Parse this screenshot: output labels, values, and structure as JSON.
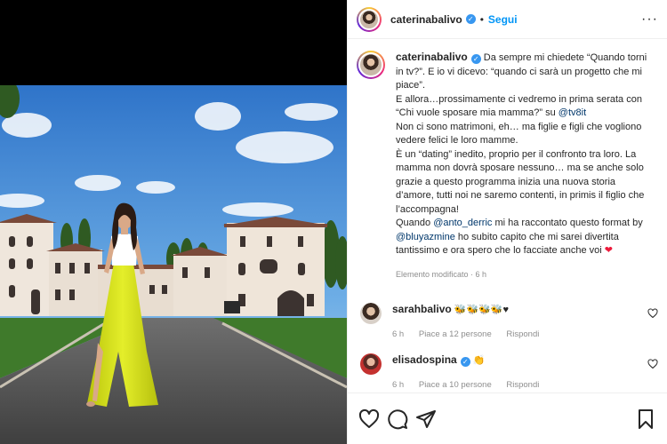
{
  "post": {
    "author": "caterinabalivo",
    "follow_label": "Segui",
    "separator": "•",
    "more_label": "···"
  },
  "caption": {
    "username": "caterinabalivo",
    "line1": "Da sempre mi chiedete “Quando torni in tv?”. E io vi dicevo: “quando ci sarà un progetto che mi piace”.",
    "line2": "E allora…prossimamente ci vedremo in prima serata con “Chi vuole sposare mia mamma?” su ",
    "mention_tv8": "@tv8it",
    "line3": "Non ci sono matrimoni, eh… ma figlie e figli che vogliono vedere felici le loro mamme.",
    "line4": "È un “dating” inedito, proprio per il confronto tra loro. La mamma non dovrà sposare nessuno… ma se anche solo grazie a questo programma inizia una nuova storia d’amore, tutti noi ne saremo contenti, in primis il figlio che l’accompagna!",
    "line5a": "Quando ",
    "mention_anto": "@anto_derric",
    "line5b": " mi ha raccontato questo format by ",
    "mention_blu": "@bluyazmine",
    "line5c": " ho subito capito che mi sarei divertita tantissimo e ora spero che lo facciate anche voi ",
    "heart": "❤",
    "meta": "Elemento modificato · 6 h"
  },
  "comments": [
    {
      "username": "sarahbalivo",
      "text": "🐝🐝🐝🐝♥",
      "time": "6 h",
      "likes": "Piace a 12 persone",
      "reply": "Rispondi"
    },
    {
      "username": "elisadospina",
      "text": "👏",
      "time": "6 h",
      "likes": "Piace a 10 persone",
      "reply": "Rispondi"
    }
  ],
  "icons": {
    "like": "heart-icon",
    "comment": "comment-icon",
    "share": "paper-plane-icon",
    "save": "bookmark-icon",
    "verified": "verified-badge-icon"
  },
  "colors": {
    "accent": "#0095f6",
    "verified": "#3897f0",
    "dress": "#d8e21a",
    "sky": "#4a8fd8"
  }
}
